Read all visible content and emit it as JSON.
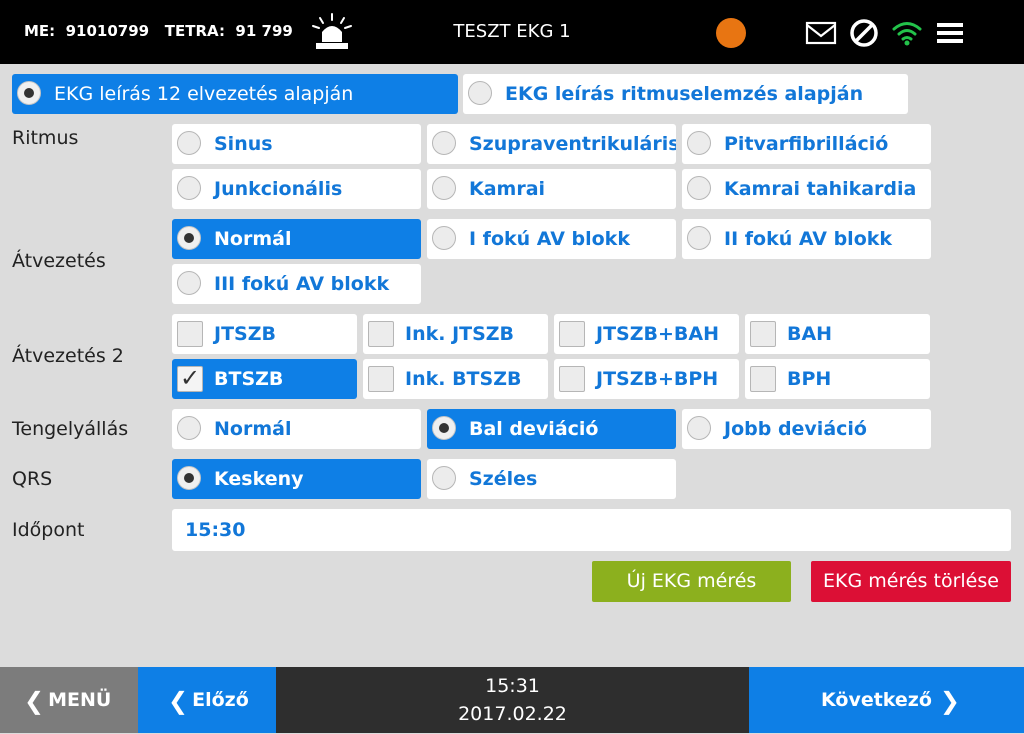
{
  "topbar": {
    "me_label": "ME:",
    "me_value": "91010799",
    "tetra_label": "TETRA:",
    "tetra_value": "91 799",
    "title": "TESZT EKG 1",
    "status_color": "#e87512"
  },
  "mode": {
    "options": [
      {
        "label": "EKG leírás 12 elvezetés alapján",
        "selected": true
      },
      {
        "label": "EKG leírás ritmuselemzés alapján",
        "selected": false
      }
    ]
  },
  "ritmus": {
    "label": "Ritmus",
    "options": [
      {
        "label": "Sinus",
        "selected": false
      },
      {
        "label": "Szupraventrikuláris",
        "selected": false
      },
      {
        "label": "Pitvarfibrilláció",
        "selected": false
      },
      {
        "label": "Junkcionális",
        "selected": false
      },
      {
        "label": "Kamrai",
        "selected": false
      },
      {
        "label": "Kamrai tahikardia",
        "selected": false
      }
    ]
  },
  "atvezetes": {
    "label": "Átvezetés",
    "options": [
      {
        "label": "Normál",
        "selected": true
      },
      {
        "label": "I fokú AV blokk",
        "selected": false
      },
      {
        "label": "II fokú AV blokk",
        "selected": false
      },
      {
        "label": "III fokú AV blokk",
        "selected": false
      }
    ]
  },
  "atvezetes2": {
    "label": "Átvezetés 2",
    "options": [
      {
        "label": "JTSZB",
        "checked": false
      },
      {
        "label": "Ink. JTSZB",
        "checked": false
      },
      {
        "label": "JTSZB+BAH",
        "checked": false
      },
      {
        "label": "BAH",
        "checked": false
      },
      {
        "label": "BTSZB",
        "checked": true
      },
      {
        "label": "Ink. BTSZB",
        "checked": false
      },
      {
        "label": "JTSZB+BPH",
        "checked": false
      },
      {
        "label": "BPH",
        "checked": false
      }
    ]
  },
  "tengely": {
    "label": "Tengelyállás",
    "options": [
      {
        "label": "Normál",
        "selected": false
      },
      {
        "label": "Bal deviáció",
        "selected": true
      },
      {
        "label": "Jobb deviáció",
        "selected": false
      }
    ]
  },
  "qrs": {
    "label": "QRS",
    "options": [
      {
        "label": "Keskeny",
        "selected": true
      },
      {
        "label": "Széles",
        "selected": false
      }
    ]
  },
  "idopont": {
    "label": "Időpont",
    "value": "15:30"
  },
  "actions": {
    "new_label": "Új EKG mérés",
    "new_color": "#8cb01e",
    "delete_label": "EKG mérés törlése",
    "delete_color": "#dc0f35"
  },
  "bottombar": {
    "menu_label": "MENÜ",
    "prev_label": "Előző",
    "next_label": "Következő",
    "time": "15:31",
    "date": "2017.02.22"
  }
}
